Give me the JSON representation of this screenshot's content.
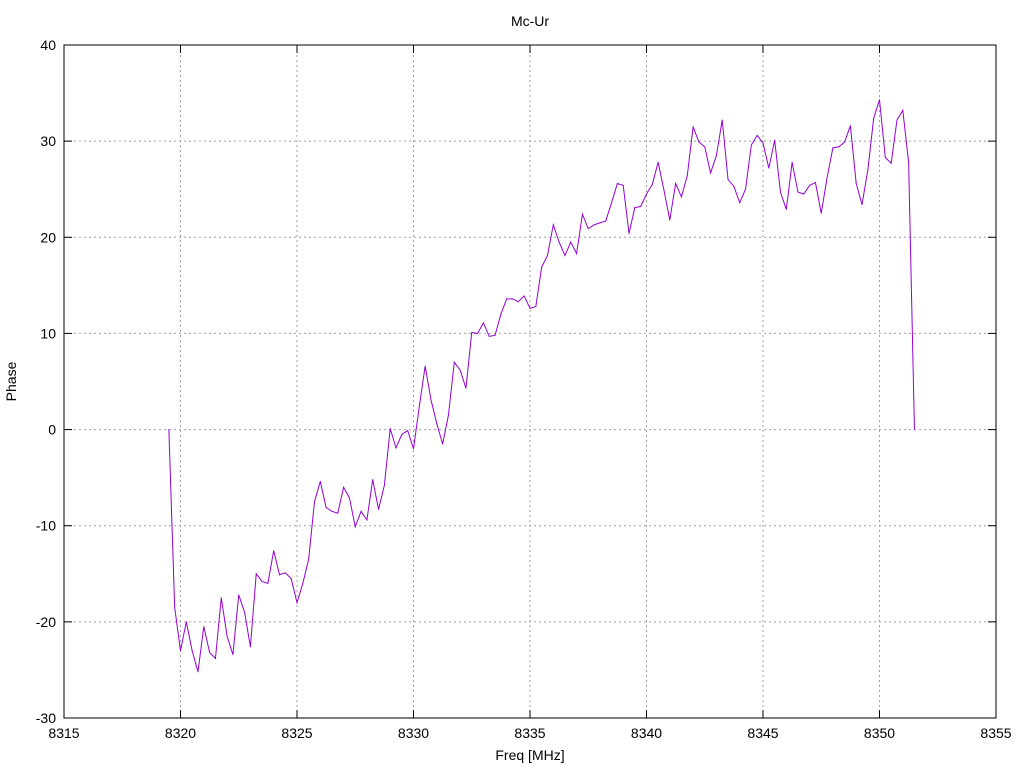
{
  "chart_data": {
    "type": "line",
    "title": "Mc-Ur",
    "xlabel": "Freq [MHz]",
    "ylabel": "Phase",
    "xlim": [
      8315,
      8355
    ],
    "ylim": [
      -30,
      40
    ],
    "x_ticks": [
      8315,
      8320,
      8325,
      8330,
      8335,
      8340,
      8345,
      8350,
      8355
    ],
    "y_ticks": [
      -30,
      -20,
      -10,
      0,
      10,
      20,
      30,
      40
    ],
    "x_tick_labels": [
      "8315",
      "8320",
      "8325",
      "8330",
      "8335",
      "8340",
      "8345",
      "8350",
      "8355"
    ],
    "y_tick_labels": [
      "-30",
      "-20",
      "-10",
      "0",
      "10",
      "20",
      "30",
      "40"
    ],
    "grid": true,
    "grid_style": "dotted",
    "legend": "none",
    "series": [
      {
        "color": "#9400d3",
        "x": [
          8319.5,
          8319.75,
          8320.0,
          8320.25,
          8320.5,
          8320.75,
          8321.0,
          8321.25,
          8321.5,
          8321.75,
          8322.0,
          8322.25,
          8322.5,
          8322.75,
          8323.0,
          8323.25,
          8323.5,
          8323.75,
          8324.0,
          8324.25,
          8324.5,
          8324.75,
          8325.0,
          8325.25,
          8325.5,
          8325.75,
          8326.0,
          8326.25,
          8326.5,
          8326.75,
          8327.0,
          8327.25,
          8327.5,
          8327.75,
          8328.0,
          8328.25,
          8328.5,
          8328.75,
          8329.0,
          8329.25,
          8329.5,
          8329.75,
          8330.0,
          8330.25,
          8330.5,
          8330.75,
          8331.0,
          8331.25,
          8331.5,
          8331.75,
          8332.0,
          8332.25,
          8332.5,
          8332.75,
          8333.0,
          8333.25,
          8333.5,
          8333.75,
          8334.0,
          8334.25,
          8334.5,
          8334.75,
          8335.0,
          8335.25,
          8335.5,
          8335.75,
          8336.0,
          8336.25,
          8336.5,
          8336.75,
          8337.0,
          8337.25,
          8337.5,
          8337.75,
          8338.0,
          8338.25,
          8338.5,
          8338.75,
          8339.0,
          8339.25,
          8339.5,
          8339.75,
          8340.0,
          8340.25,
          8340.5,
          8340.75,
          8341.0,
          8341.25,
          8341.5,
          8341.75,
          8342.0,
          8342.25,
          8342.5,
          8342.75,
          8343.0,
          8343.25,
          8343.5,
          8343.75,
          8344.0,
          8344.25,
          8344.5,
          8344.75,
          8345.0,
          8345.25,
          8345.5,
          8345.75,
          8346.0,
          8346.25,
          8346.5,
          8346.75,
          8347.0,
          8347.25,
          8347.5,
          8347.75,
          8348.0,
          8348.25,
          8348.5,
          8348.75,
          8349.0,
          8349.25,
          8349.5,
          8349.75,
          8350.0,
          8350.25,
          8350.5,
          8350.75,
          8351.0,
          8351.25,
          8351.5
        ],
        "y": [
          0.0,
          -18.5,
          -23.0,
          -20.0,
          -23.0,
          -25.2,
          -20.5,
          -23.2,
          -23.8,
          -17.5,
          -21.5,
          -23.4,
          -17.2,
          -19.0,
          -22.6,
          -15.0,
          -15.8,
          -16.0,
          -12.6,
          -15.1,
          -14.9,
          -15.5,
          -18.0,
          -16.0,
          -13.5,
          -7.5,
          -5.4,
          -8.1,
          -8.5,
          -8.7,
          -6.0,
          -7.1,
          -10.1,
          -8.5,
          -9.4,
          -5.2,
          -8.3,
          -5.8,
          0.1,
          -1.9,
          -0.5,
          -0.1,
          -2.0,
          2.4,
          6.6,
          3.1,
          0.6,
          -1.5,
          1.5,
          7.0,
          6.2,
          4.3,
          10.1,
          10.0,
          11.1,
          9.7,
          9.8,
          12.0,
          13.6,
          13.6,
          13.3,
          13.9,
          12.6,
          12.8,
          16.9,
          18.1,
          21.3,
          19.5,
          18.1,
          19.5,
          18.3,
          22.4,
          20.9,
          21.3,
          21.5,
          21.7,
          23.6,
          25.6,
          25.4,
          20.4,
          23.1,
          23.2,
          24.5,
          25.5,
          27.8,
          24.9,
          21.8,
          25.6,
          24.2,
          26.4,
          31.5,
          29.9,
          29.4,
          26.7,
          28.5,
          32.2,
          26.0,
          25.3,
          23.6,
          25.0,
          29.6,
          30.6,
          29.8,
          27.2,
          30.1,
          24.7,
          22.9,
          27.8,
          24.7,
          24.5,
          25.4,
          25.7,
          22.5,
          26.2,
          29.3,
          29.4,
          29.9,
          31.6,
          25.6,
          23.4,
          27.0,
          32.4,
          34.3,
          28.3,
          27.7,
          32.2,
          33.2,
          27.8,
          0.0
        ]
      }
    ]
  }
}
